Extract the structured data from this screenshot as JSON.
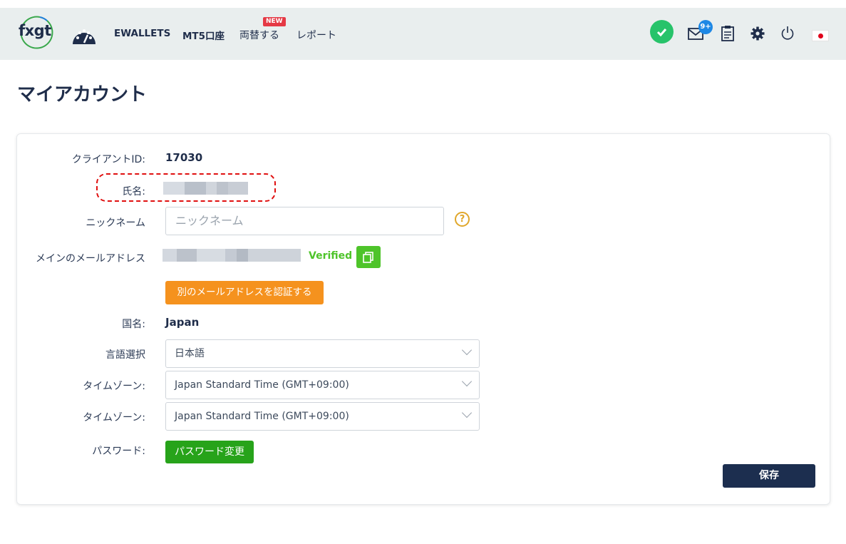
{
  "header": {
    "logo_text": "fxgt",
    "nav": {
      "ewallets": "EWALLETS",
      "mt5": "MT5口座",
      "exchange": "両替する",
      "exchange_badge": "NEW",
      "reports": "レポート"
    },
    "mail_badge": "9+"
  },
  "page": {
    "title": "マイアカウント"
  },
  "form": {
    "client_id_label": "クライアントID:",
    "client_id_value": "17030",
    "name_label": "氏名:",
    "nickname_label": "ニックネーム",
    "nickname_placeholder": "ニックネーム",
    "help_glyph": "?",
    "email_label": "メインのメールアドレス",
    "email_status": "Verified",
    "verify_other_email_button": "別のメールアドレスを認証する",
    "country_label": "国名:",
    "country_value": "Japan",
    "language_label": "言語選択",
    "language_value": "日本語",
    "timezone1_label": "タイムゾーン:",
    "timezone1_value": "Japan Standard Time (GMT+09:00)",
    "timezone2_label": "タイムゾーン:",
    "timezone2_value": "Japan Standard Time (GMT+09:00)",
    "password_label": "パスワード:",
    "change_password_button": "パスワード変更",
    "save_button": "保存"
  },
  "colors": {
    "brand_navy": "#1c2e4f",
    "verified_green": "#4ec42a",
    "orange": "#f5921e",
    "password_green": "#27a31a",
    "highlight_red": "#e01010"
  }
}
